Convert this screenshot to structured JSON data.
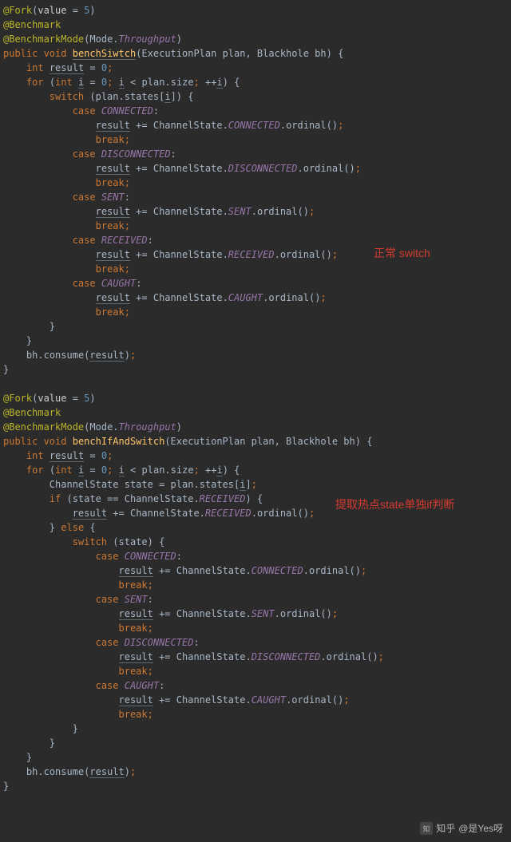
{
  "annotations": {
    "fork": "@Fork",
    "benchmark": "@Benchmark",
    "benchmarkMode": "@BenchmarkMode",
    "forkValueLabel": "value",
    "forkValueNum": "5",
    "modeClass": "Mode",
    "throughput": "Throughput"
  },
  "method1": {
    "modifiers": "public void",
    "name": "benchSiwtch",
    "params": "(ExecutionPlan plan, Blackhole bh)"
  },
  "method2": {
    "modifiers": "public void",
    "name": "benchIfAndSwitch",
    "params": "(ExecutionPlan plan, Blackhole bh)"
  },
  "body": {
    "result": "result",
    "zero": "0",
    "i": "i",
    "plan": "plan",
    "states": "states",
    "size": "size",
    "channelState": "ChannelState",
    "ordinal": "ordinal",
    "consume": "consume",
    "stateVar": "state",
    "bh": "bh"
  },
  "cases": {
    "CONNECTED": "CONNECTED",
    "DISCONNECTED": "DISCONNECTED",
    "SENT": "SENT",
    "RECEIVED": "RECEIVED",
    "CAUGHT": "CAUGHT"
  },
  "keywords": {
    "int": "int",
    "for": "for",
    "switch": "switch",
    "case": "case",
    "break": "break",
    "if": "if",
    "else": "else"
  },
  "overlay": {
    "label1": "正常 switch",
    "label2": "提取热点state单独if判断"
  },
  "watermark": {
    "site": "知乎",
    "author": "@是Yes呀"
  }
}
